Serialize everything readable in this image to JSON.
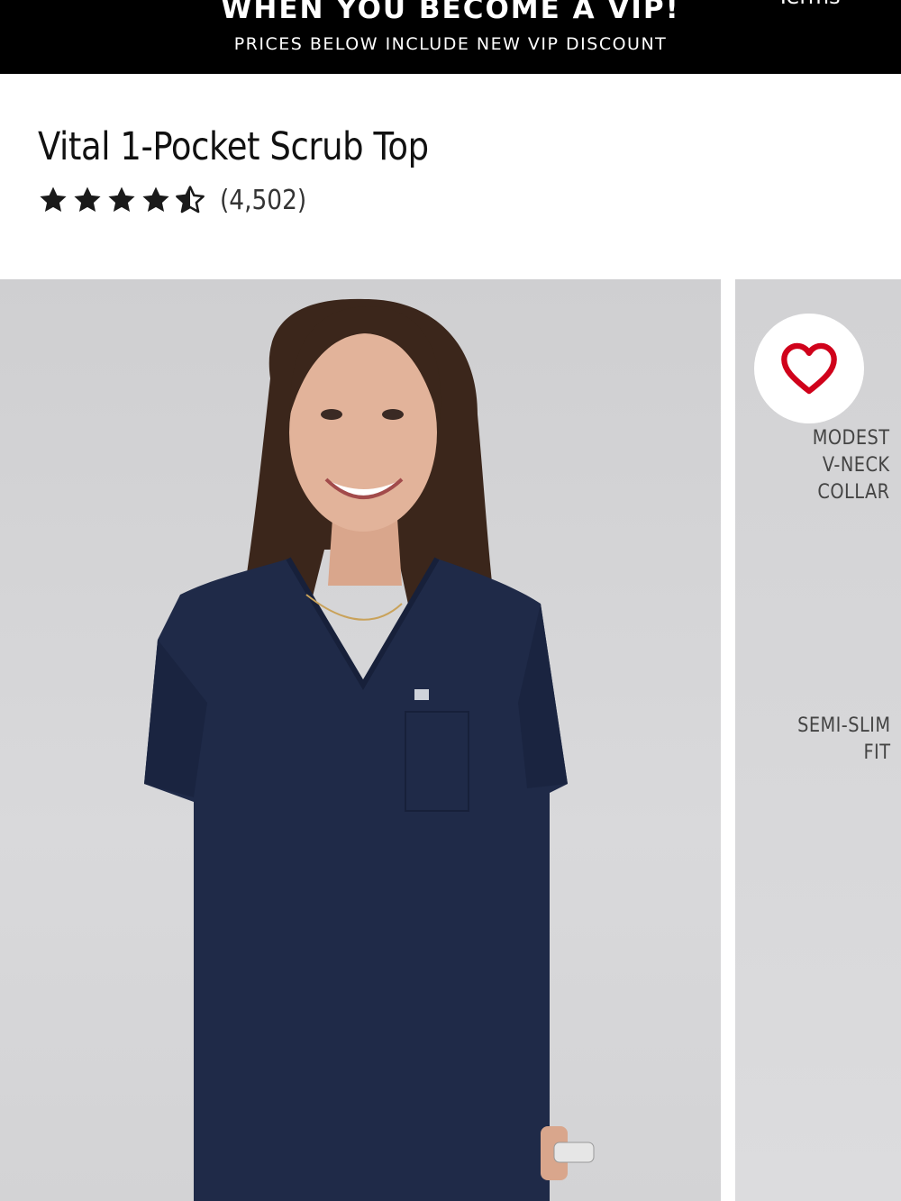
{
  "promo_banner": {
    "headline": "WHEN YOU BECOME A VIP!",
    "subline": "PRICES BELOW INCLUDE NEW VIP DISCOUNT",
    "terms_link": "Terms"
  },
  "product": {
    "title": "Vital 1-Pocket Scrub Top",
    "rating": 4.5,
    "rating_max": 5,
    "review_count": "(4,502)"
  },
  "gallery": {
    "main_image_alt": "Model wearing navy scrub top",
    "features": [
      {
        "lines": [
          "MODEST",
          "V-NECK",
          "COLLAR"
        ]
      },
      {
        "lines": [
          "SEMI-SLIM",
          "FIT"
        ]
      }
    ]
  },
  "colors": {
    "banner_bg": "#000000",
    "scrub_navy": "#1f2a48",
    "heart_red": "#d0021b",
    "star": "#1a1a1a"
  },
  "icons": {
    "star": "star-icon",
    "half_star": "half-star-icon",
    "favorite": "heart-icon"
  }
}
